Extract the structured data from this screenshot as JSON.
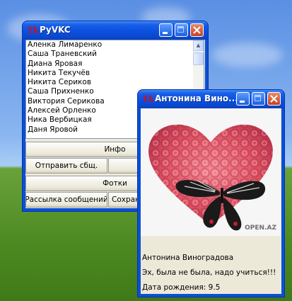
{
  "main_window": {
    "title": "PyVKC",
    "friends": [
      "Аленка Лимаренко",
      "Саша Траневский",
      "Диана Яровая",
      "Никита Текучёв",
      "Никита Сериков",
      "Саша Прихненко",
      "Виктория Серикова",
      "Алексей Орленко",
      "Ника Вербицкая",
      "Даня Яровой"
    ],
    "buttons": {
      "info": "Инфо",
      "send_message": "Отправить сбщ.",
      "photos": "Фотки",
      "mailing": "Рассылка сообщений",
      "save": "Сохранить"
    }
  },
  "profile_window": {
    "title": "Антонина Вино...",
    "photo_watermark": "OPEN.AZ",
    "name": "Антонина Виноградова",
    "status": "Эх, была не была, надо учиться!!!",
    "birthday": "Дата рождения: 9.5"
  },
  "icons": {
    "tk": "Tk",
    "minimize": "minimize-icon",
    "maximize": "maximize-icon",
    "close": "close-icon"
  }
}
